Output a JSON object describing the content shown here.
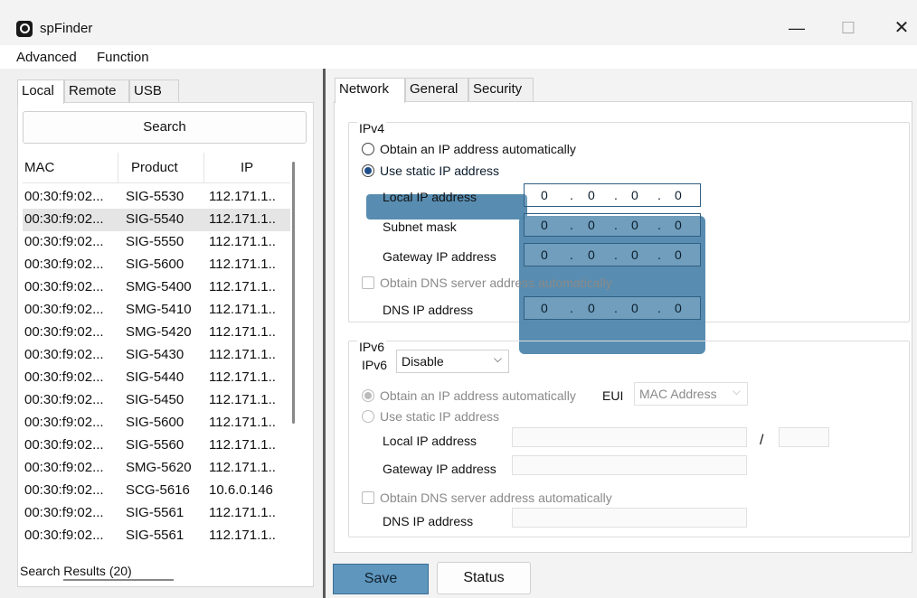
{
  "window": {
    "title": "spFinder",
    "minimize_glyph": "—",
    "maximize_glyph": "☐",
    "close_glyph": "✕"
  },
  "menu": {
    "items": [
      "Advanced",
      "Function"
    ]
  },
  "left": {
    "tabs": [
      "Local",
      "Remote",
      "USB"
    ],
    "search_label": "Search",
    "columns": [
      "MAC",
      "Product",
      "IP"
    ],
    "rows": [
      {
        "mac": "00:30:f9:02...",
        "product": "SIG-5530",
        "ip": "112.171.1.."
      },
      {
        "mac": "00:30:f9:02...",
        "product": "SIG-5540",
        "ip": "112.171.1.."
      },
      {
        "mac": "00:30:f9:02...",
        "product": "SIG-5550",
        "ip": "112.171.1.."
      },
      {
        "mac": "00:30:f9:02...",
        "product": "SIG-5600",
        "ip": "112.171.1.."
      },
      {
        "mac": "00:30:f9:02...",
        "product": "SMG-5400",
        "ip": "112.171.1.."
      },
      {
        "mac": "00:30:f9:02...",
        "product": "SMG-5410",
        "ip": "112.171.1.."
      },
      {
        "mac": "00:30:f9:02...",
        "product": "SMG-5420",
        "ip": "112.171.1.."
      },
      {
        "mac": "00:30:f9:02...",
        "product": "SIG-5430",
        "ip": "112.171.1.."
      },
      {
        "mac": "00:30:f9:02...",
        "product": "SIG-5440",
        "ip": "112.171.1.."
      },
      {
        "mac": "00:30:f9:02...",
        "product": "SIG-5450",
        "ip": "112.171.1.."
      },
      {
        "mac": "00:30:f9:02...",
        "product": "SIG-5600",
        "ip": "112.171.1.."
      },
      {
        "mac": "00:30:f9:02...",
        "product": "SIG-5560",
        "ip": "112.171.1.."
      },
      {
        "mac": "00:30:f9:02...",
        "product": "SMG-5620",
        "ip": "112.171.1.."
      },
      {
        "mac": "00:30:f9:02...",
        "product": "SCG-5616",
        "ip": "10.6.0.146"
      },
      {
        "mac": "00:30:f9:02...",
        "product": "SIG-5561",
        "ip": "112.171.1.."
      },
      {
        "mac": "00:30:f9:02...",
        "product": "SIG-5561",
        "ip": "112.171.1.."
      }
    ],
    "results_label": "Search Results (20)"
  },
  "right": {
    "tabs": [
      "Network",
      "General",
      "Security"
    ],
    "ipv4": {
      "title": "IPv4",
      "obtain_auto": "Obtain an IP address automatically",
      "use_static": "Use static IP address",
      "local_ip_label": "Local IP address",
      "subnet_label": "Subnet mask",
      "gateway_label": "Gateway IP address",
      "dns_auto": "Obtain DNS server address automatically",
      "dns_label": "DNS IP address",
      "local_ip": [
        "0",
        "0",
        "0",
        "0"
      ],
      "subnet": [
        "0",
        "0",
        "0",
        "0"
      ],
      "gateway": [
        "0",
        "0",
        "0",
        "0"
      ],
      "dns": [
        "0",
        "0",
        "0",
        "0"
      ],
      "dot": "."
    },
    "ipv6": {
      "title": "IPv6",
      "mode_label": "IPv6",
      "mode_value": "Disable",
      "obtain_auto": "Obtain an IP address automatically",
      "eui_label": "EUI",
      "eui_value": "MAC Address",
      "use_static": "Use static IP address",
      "local_ip_label": "Local IP address",
      "prefix_sep": "/",
      "gateway_label": "Gateway IP address",
      "dns_auto": "Obtain DNS server address automatically",
      "dns_label": "DNS IP address"
    },
    "save_label": "Save",
    "status_label": "Status"
  },
  "colors": {
    "highlight": "#4f87ad",
    "radio_selected": "#1f4f8a"
  },
  "icons": [
    "app-logo-icon",
    "minimize-icon",
    "maximize-icon",
    "close-icon",
    "chevron-down-icon"
  ]
}
